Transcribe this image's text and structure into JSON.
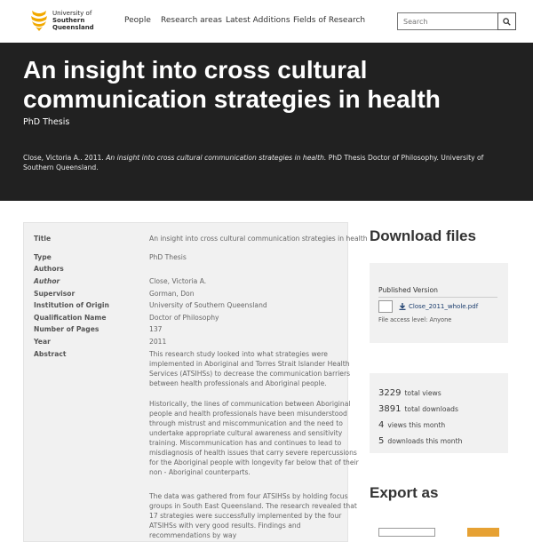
{
  "header": {
    "logo_lines": [
      "University of",
      "Southern",
      "Queensland"
    ],
    "nav": [
      "People",
      "Research areas",
      "Latest Additions",
      "Fields of Research"
    ],
    "search_placeholder": "Search"
  },
  "hero": {
    "title": "An insight into cross cultural communication strategies in health",
    "subtitle": "PhD Thesis",
    "citation_prefix": "Close, Victoria A.. 2011.",
    "citation_title": "An insight into cross cultural communication strategies in health.",
    "citation_suffix": "PhD Thesis Doctor of Philosophy. University of Southern Queensland."
  },
  "record": {
    "title_label": "Title",
    "title_value": "An insight into cross cultural communication strategies in health",
    "type_label": "Type",
    "type_value": "PhD Thesis",
    "authors_label": "Authors",
    "author_label": "Author",
    "author_value": "Close, Victoria A.",
    "supervisor_label": "Supervisor",
    "supervisor_value": "Gorman, Don",
    "institution_label": "Institution of Origin",
    "institution_value": "University of Southern Queensland",
    "qualification_label": "Qualification Name",
    "qualification_value": "Doctor of Philosophy",
    "pages_label": "Number of Pages",
    "pages_value": "137",
    "year_label": "Year",
    "year_value": "2011",
    "abstract_label": "Abstract",
    "abstract_p1": "This research study looked into what strategies were implemented in Aboriginal and Torres Strait Islander Health Services (ATSIHSs) to decrease the communication barriers between health professionals and Aboriginal people.",
    "abstract_p2": "Historically, the lines of communication between Aboriginal people and health professionals have been misunderstood through mistrust and miscommunication and the need to undertake appropriate cultural awareness and sensitivity training. Miscommunication has and continues to lead to misdiagnosis of health issues that carry severe repercussions for the Aboriginal people with longevity far below that of their non - Aboriginal counterparts.",
    "abstract_p3": "The data was gathered from four ATSIHSs by holding focus groups in South East Queensland. The research revealed that 17 strategies were successfully implemented by the four ATSIHSs with very good results. Findings and recommendations by way"
  },
  "downloads": {
    "heading": "Download files",
    "version_label": "Published Version",
    "file_name": "Close_2011_whole.pdf",
    "access": "File access level: Anyone"
  },
  "stats": [
    {
      "num": "3229",
      "label": "total views"
    },
    {
      "num": "3891",
      "label": "total downloads"
    },
    {
      "num": "4",
      "label": "views this month"
    },
    {
      "num": "5",
      "label": "downloads this month"
    }
  ],
  "export": {
    "heading": "Export as"
  },
  "colors": {
    "hero_bg": "#212121",
    "panel_bg": "#f1f1f1",
    "logo_gold": "#f2a900",
    "link_blue": "#1b3d6d",
    "export_button": "#e6a133"
  }
}
